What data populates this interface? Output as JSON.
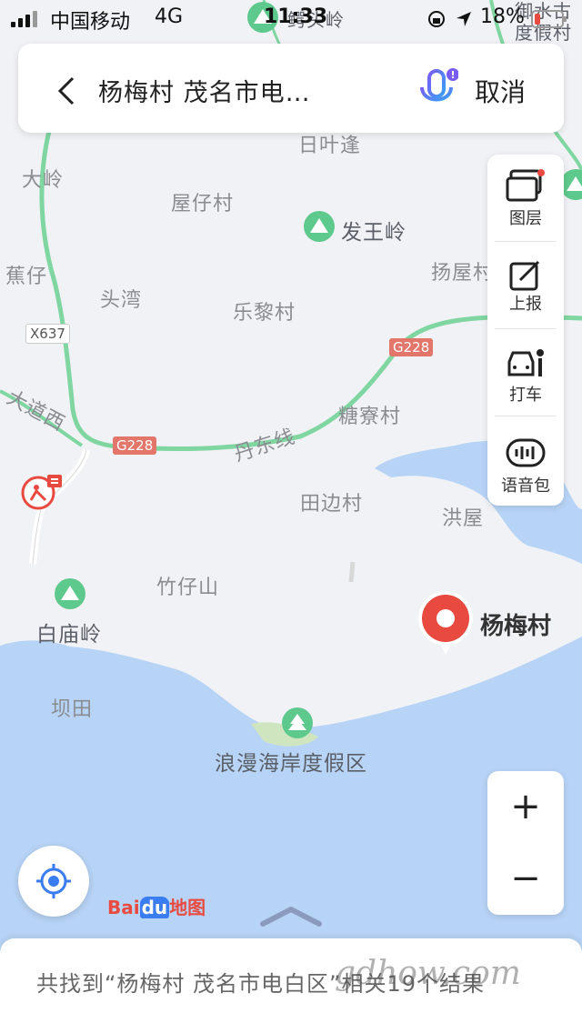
{
  "status_bar": {
    "carrier": "中国移动",
    "network": "4G",
    "time": "11:33",
    "battery": "18%"
  },
  "search": {
    "query": "杨梅村 茂名市电…",
    "cancel_label": "取消"
  },
  "toolbar": {
    "items": [
      {
        "label": "图层",
        "icon": "layers-icon"
      },
      {
        "label": "上报",
        "icon": "report-icon"
      },
      {
        "label": "打车",
        "icon": "taxi-icon"
      },
      {
        "label": "语音包",
        "icon": "voice-pack-icon"
      }
    ]
  },
  "zoom": {
    "in_label": "+",
    "out_label": "−"
  },
  "map": {
    "places": [
      {
        "name": "大岭"
      },
      {
        "name": "屋仔村"
      },
      {
        "name": "发王岭"
      },
      {
        "name": "扬屋村"
      },
      {
        "name": "蕉仔"
      },
      {
        "name": "头湾"
      },
      {
        "name": "乐黎村"
      },
      {
        "name": "大道西"
      },
      {
        "name": "糖寮村"
      },
      {
        "name": "丹东线"
      },
      {
        "name": "田边村"
      },
      {
        "name": "洪屋"
      },
      {
        "name": "竹仔山"
      },
      {
        "name": "白庙岭"
      },
      {
        "name": "坝田"
      },
      {
        "name": "浪漫海岸度假区"
      },
      {
        "name": "日叶逢"
      },
      {
        "name": "鳄头岭"
      },
      {
        "name": "御水古度假村"
      }
    ],
    "road_badges": [
      "X637",
      "G228",
      "G228"
    ],
    "selected_poi": "杨梅村"
  },
  "logo": {
    "text_bai": "Bai",
    "text_du": "du",
    "text_map": "地图"
  },
  "result_text": "共找到“杨梅村 茂名市电白区”相关19个结果",
  "watermark": "gdhow.com",
  "colors": {
    "water": "#b7d3f5",
    "road": "#7fd6a0",
    "poi_red": "#e84a3f",
    "park_green": "#5ec98c",
    "accent_blue": "#3a7df0"
  }
}
